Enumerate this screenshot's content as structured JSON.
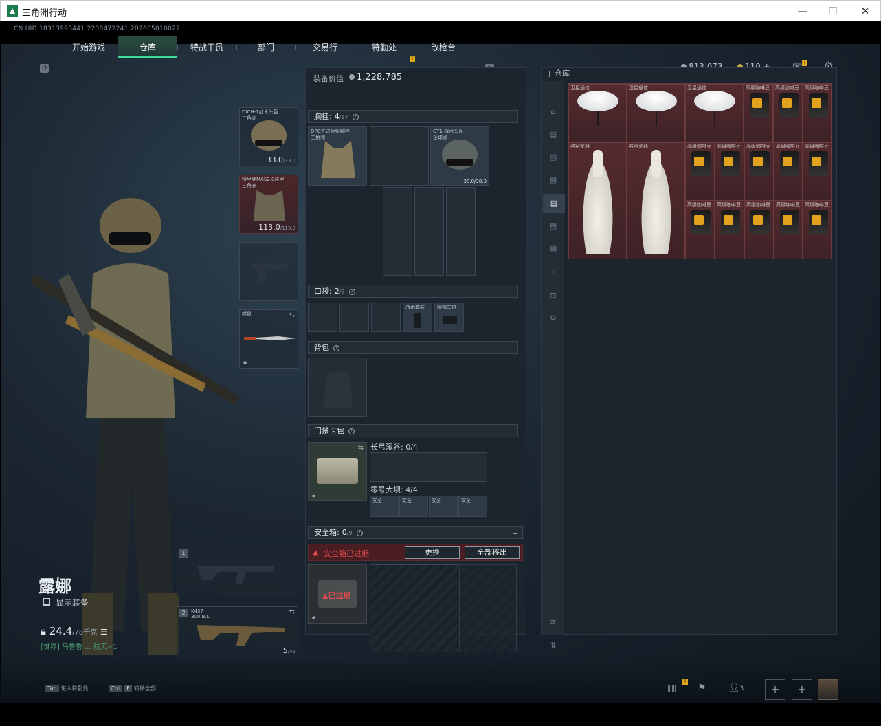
{
  "window": {
    "title": "三角洲行动",
    "minimize": "—",
    "maximize": "☐",
    "close": "✕"
  },
  "uid": "CN UID 18313998441 2238472241,202605010022",
  "nav": {
    "left_key": "Q",
    "right_key": "E",
    "tabs": [
      "开始游戏",
      "仓库",
      "特战干员",
      "部门",
      "交易行",
      "特勤处",
      "改枪台"
    ],
    "active": "仓库",
    "badge": "!"
  },
  "currency": {
    "coins": "813,073",
    "tokens": "110",
    "plus": "+"
  },
  "character": {
    "name": "露娜",
    "show_equipment": "显示装备",
    "weight": "24.4",
    "weight_max": "/78千克",
    "world_msg": "[世界] 乌鲁鲁 ... 航天=1"
  },
  "equipment": {
    "helmet": {
      "name": "DICH-1战术头盔",
      "sub": "三角洲",
      "durability": "33.0",
      "max": "/33.0"
    },
    "armor": {
      "name": "特里克MAS2.0装甲",
      "sub": "三角洲",
      "durability": "113.0",
      "max": "/113.0"
    },
    "melee": {
      "name": "喵星"
    },
    "weapon1": {
      "slot": "1"
    },
    "weapon2": {
      "slot": "2",
      "name": "K437",
      "sub": "300 B.L.",
      "ammo": "5",
      "ammo_max": "/45"
    }
  },
  "loadout": {
    "value_label": "装备价值",
    "value": "1,228,785",
    "chest": {
      "label": "胸挂:",
      "count": "4",
      "max": "/17",
      "item1": "DRC先进侦察胸挂",
      "item1_sub": "三角洲",
      "item2": "GT1 战术头盔",
      "item2_sub": "全球点",
      "item2_dura": "38.0/38.0"
    },
    "pockets": {
      "label": "口袋:",
      "count": "2",
      "max": "/5",
      "item1": "战术套装",
      "item2": "精钢二倍"
    },
    "backpack": {
      "label": "背包"
    },
    "keycard": {
      "label": "门禁卡包",
      "zone1": "长弓溪谷: 0/4",
      "zone2": "零号大坝: 4/4",
      "card_label": "安全"
    },
    "safebox": {
      "label": "安全箱:",
      "count": "0",
      "max": "/9",
      "warning": "安全箱已过期",
      "replace": "更换",
      "remove_all": "全部移出",
      "expired": "已过期"
    }
  },
  "warehouse": {
    "title": "仓库",
    "items": [
      {
        "name": "卫星通信",
        "type": "dish"
      },
      {
        "name": "卫星通信",
        "type": "dish"
      },
      {
        "name": "卫星通信",
        "type": "dish"
      },
      {
        "name": "高级咖啡豆",
        "type": "coffee"
      },
      {
        "name": "高级咖啡豆",
        "type": "coffee"
      },
      {
        "name": "高级咖啡豆",
        "type": "coffee"
      },
      {
        "name": "名窑瓷器",
        "type": "vase"
      },
      {
        "name": "名窑瓷器",
        "type": "vase"
      },
      {
        "name": "高级咖啡豆",
        "type": "coffee"
      }
    ],
    "side_icons": [
      "shop-icon",
      "page-1",
      "page-2",
      "page-3",
      "page-4",
      "page-5",
      "page-6",
      "add-icon",
      "lock-icon",
      "gear-icon",
      "layers-icon",
      "sort-icon"
    ]
  },
  "bottom": {
    "hint1_key": "Tab",
    "hint1": "进入特勤处",
    "hint2_key": "Ctrl",
    "hint2_key2": "F",
    "hint2": "转移全部",
    "friends": "3"
  }
}
